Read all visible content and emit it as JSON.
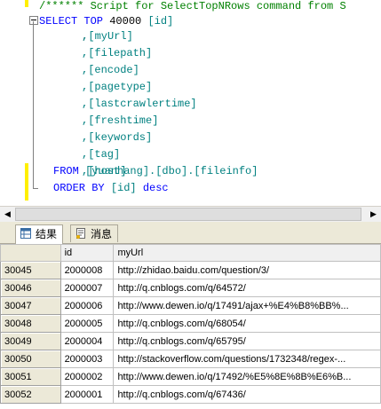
{
  "editor": {
    "lines": [
      {
        "kind": "comment",
        "text": "/****** Script for SelectTopNRows command from S"
      },
      {
        "kind": "select",
        "kw": "SELECT TOP",
        "num": " 40000 ",
        "ident": "[id]"
      },
      {
        "kind": "col",
        "text": ",[myUrl]"
      },
      {
        "kind": "col",
        "text": ",[filepath]"
      },
      {
        "kind": "col",
        "text": ",[encode]"
      },
      {
        "kind": "col",
        "text": ",[pagetype]"
      },
      {
        "kind": "col",
        "text": ",[lastcrawlertime]"
      },
      {
        "kind": "col",
        "text": ",[freshtime]"
      },
      {
        "kind": "col",
        "text": ",[keywords]"
      },
      {
        "kind": "col",
        "text": ",[tag]"
      },
      {
        "kind": "col",
        "text": ",[host]"
      },
      {
        "kind": "from",
        "kw": "FROM ",
        "ident": "[yuanhang].[dbo].[fileinfo]"
      },
      {
        "kind": "order",
        "kw": "ORDER BY ",
        "ident": "[id]",
        "kw2": " desc"
      }
    ]
  },
  "tabs": {
    "results_label": "结果",
    "messages_label": "消息"
  },
  "grid": {
    "columns": [
      "",
      "id",
      "myUrl"
    ],
    "rows": [
      {
        "num": "30045",
        "id": "2000008",
        "url": "http://zhidao.baidu.com/question/3/"
      },
      {
        "num": "30046",
        "id": "2000007",
        "url": "http://q.cnblogs.com/q/64572/"
      },
      {
        "num": "30047",
        "id": "2000006",
        "url": "http://www.dewen.io/q/17491/ajax+%E4%B8%BB%..."
      },
      {
        "num": "30048",
        "id": "2000005",
        "url": "http://q.cnblogs.com/q/68054/"
      },
      {
        "num": "30049",
        "id": "2000004",
        "url": "http://q.cnblogs.com/q/65795/"
      },
      {
        "num": "30050",
        "id": "2000003",
        "url": "http://stackoverflow.com/questions/1732348/regex-..."
      },
      {
        "num": "30051",
        "id": "2000002",
        "url": "http://www.dewen.io/q/17492/%E5%8E%8B%E6%B..."
      },
      {
        "num": "30052",
        "id": "2000001",
        "url": "http://q.cnblogs.com/q/67436/"
      }
    ]
  }
}
